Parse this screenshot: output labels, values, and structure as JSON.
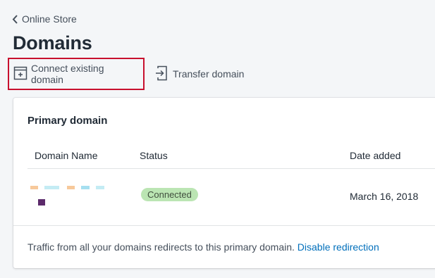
{
  "breadcrumb": {
    "label": "Online Store"
  },
  "page": {
    "title": "Domains"
  },
  "actions": {
    "connect_label": "Connect existing domain",
    "transfer_label": "Transfer domain"
  },
  "primary_domain": {
    "title": "Primary domain",
    "columns": [
      "Domain Name",
      "Status",
      "Date added"
    ],
    "rows": [
      {
        "domain_name": "",
        "status": "Connected",
        "date_added": "March 16, 2018"
      }
    ],
    "footer_text": "Traffic from all your domains redirects to this primary domain.",
    "footer_link": "Disable redirection"
  },
  "colors": {
    "highlight_border": "#c8102e",
    "link": "#006fbb",
    "status_badge_bg": "#bbe5b3"
  },
  "icons": {
    "back": "chevron-left-icon",
    "connect": "browser-plus-icon",
    "transfer": "transfer-icon"
  }
}
